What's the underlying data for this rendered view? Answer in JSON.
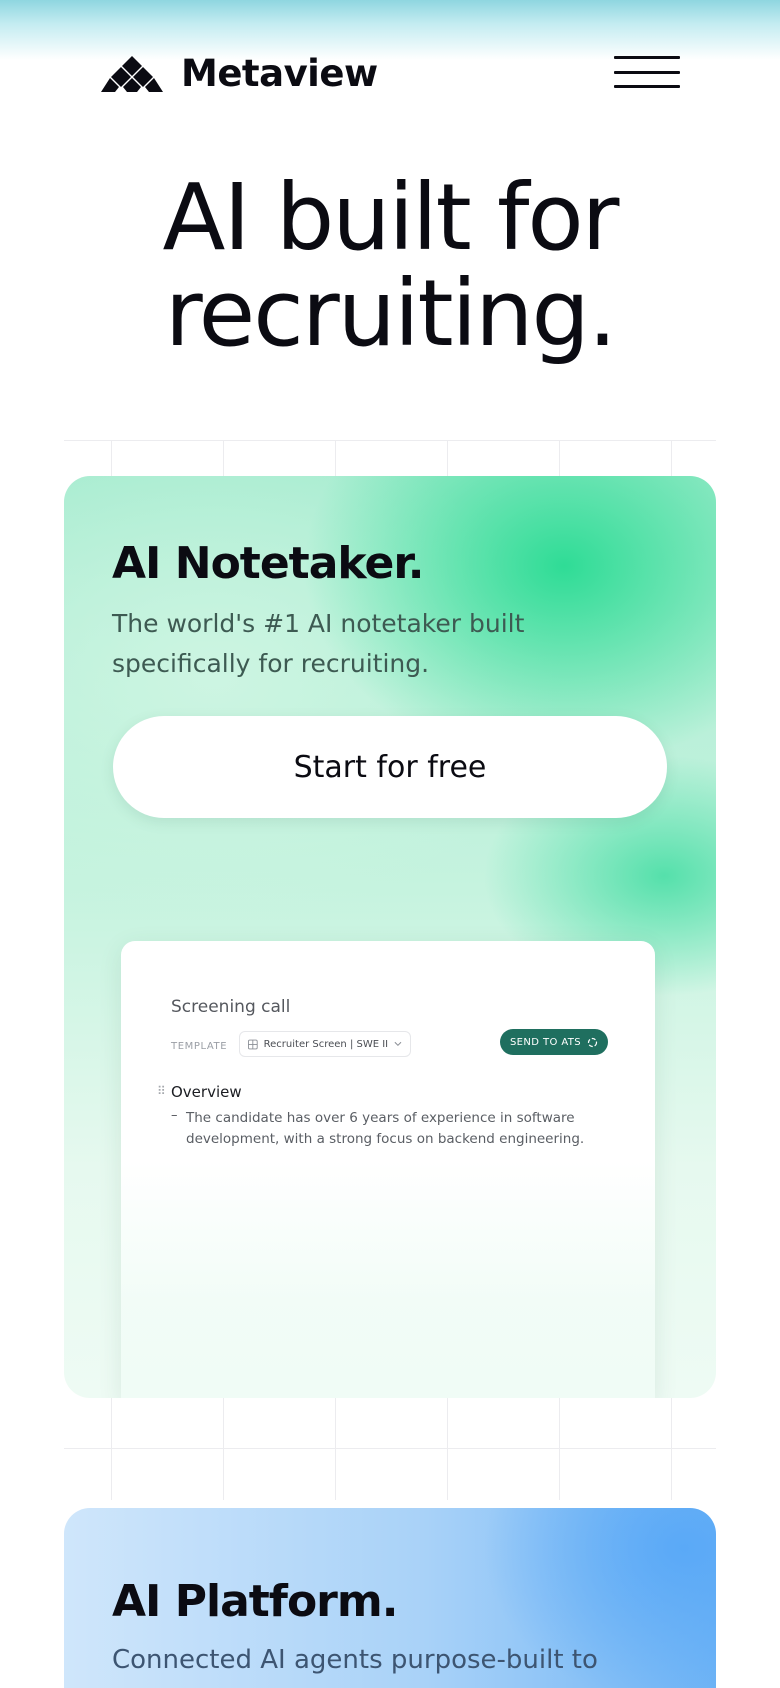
{
  "header": {
    "logo_text": "Metaview",
    "menu_icon": "hamburger-icon"
  },
  "hero": {
    "title_line1": "AI built for",
    "title_line2": "recruiting."
  },
  "notetaker_card": {
    "title": "AI Notetaker.",
    "subtitle": "The world's #1 AI notetaker built specifically for recruiting.",
    "cta_label": "Start for free",
    "accent_color": "#2fdc96",
    "preview": {
      "title": "Screening call",
      "template_label": "TEMPLATE",
      "template_value": "Recruiter Screen | SWE II",
      "send_button_label": "SEND TO ATS",
      "send_button_color": "#1f6f5f",
      "section_heading": "Overview",
      "bullet_text": "The candidate has over 6 years of experience in software development, with a strong focus on backend engineering."
    }
  },
  "platform_card": {
    "title": "AI Platform.",
    "subtitle": "Connected AI agents purpose-built to",
    "accent_color": "#5aa9f7"
  }
}
